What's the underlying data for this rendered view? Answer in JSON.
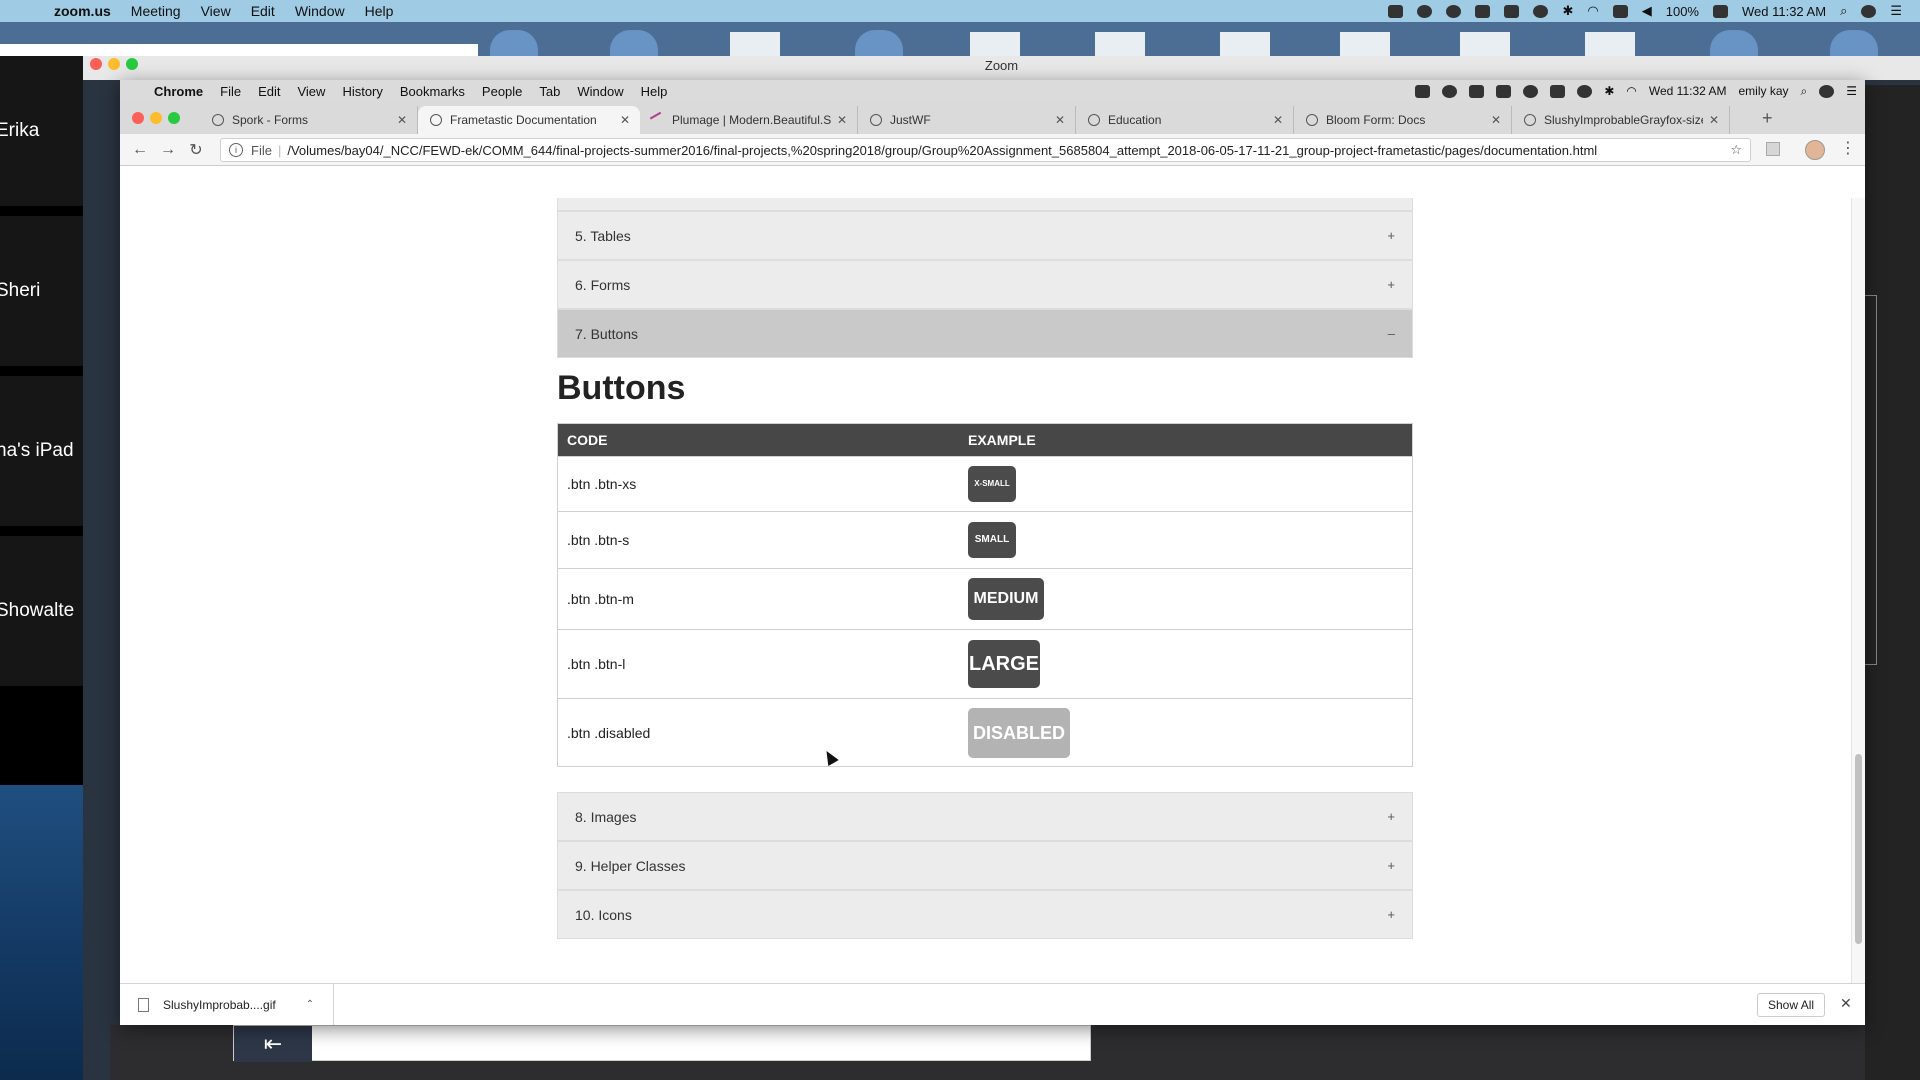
{
  "mac_menubar": {
    "app": "zoom.us",
    "items": [
      "Meeting",
      "View",
      "Edit",
      "Window",
      "Help"
    ],
    "battery": "100%",
    "clock": "Wed 11:32 AM"
  },
  "zoom": {
    "window_title": "Zoom",
    "participants": [
      "Erika",
      "Sheri",
      "na's iPad",
      "Showalte"
    ]
  },
  "chrome": {
    "menubar": {
      "app": "Chrome",
      "items": [
        "File",
        "Edit",
        "View",
        "History",
        "Bookmarks",
        "People",
        "Tab",
        "Window",
        "Help"
      ],
      "clock": "Wed 11:32 AM",
      "user": "emily kay"
    },
    "tabs": [
      {
        "title": "Spork - Forms"
      },
      {
        "title": "Frametastic Documentation"
      },
      {
        "title": "Plumage | Modern.Beautiful.Si"
      },
      {
        "title": "JustWF"
      },
      {
        "title": "Education"
      },
      {
        "title": "Bloom Form: Docs"
      },
      {
        "title": "SlushyImprobableGrayfox-size"
      }
    ],
    "url_prefix": "File",
    "url": "/Volumes/bay04/_NCC/FEWD-ek/COMM_644/final-projects-summer2016/final-projects,%20spring2018/group/Group%20Assignment_5685804_attempt_2018-06-05-17-11-21_group-project-frametastic/pages/documentation.html"
  },
  "page": {
    "accordion_above": [
      {
        "label": "5. Tables",
        "sign": "+"
      },
      {
        "label": "6. Forms",
        "sign": "+"
      },
      {
        "label": "7. Buttons",
        "sign": "–"
      }
    ],
    "section_title": "Buttons",
    "table": {
      "headers": [
        "CODE",
        "EXAMPLE"
      ],
      "rows": [
        {
          "code": ".btn .btn-xs",
          "example": "X-SMALL"
        },
        {
          "code": ".btn .btn-s",
          "example": "SMALL"
        },
        {
          "code": ".btn .btn-m",
          "example": "MEDIUM"
        },
        {
          "code": ".btn .btn-l",
          "example": "LARGE"
        },
        {
          "code": ".btn .disabled",
          "example": "DISABLED"
        }
      ]
    },
    "accordion_below": [
      {
        "label": "8. Images",
        "sign": "+"
      },
      {
        "label": "9. Helper Classes",
        "sign": "+"
      },
      {
        "label": "10. Icons",
        "sign": "+"
      }
    ]
  },
  "downloads": {
    "file": "SlushyImprobab....gif",
    "show_all": "Show All"
  }
}
